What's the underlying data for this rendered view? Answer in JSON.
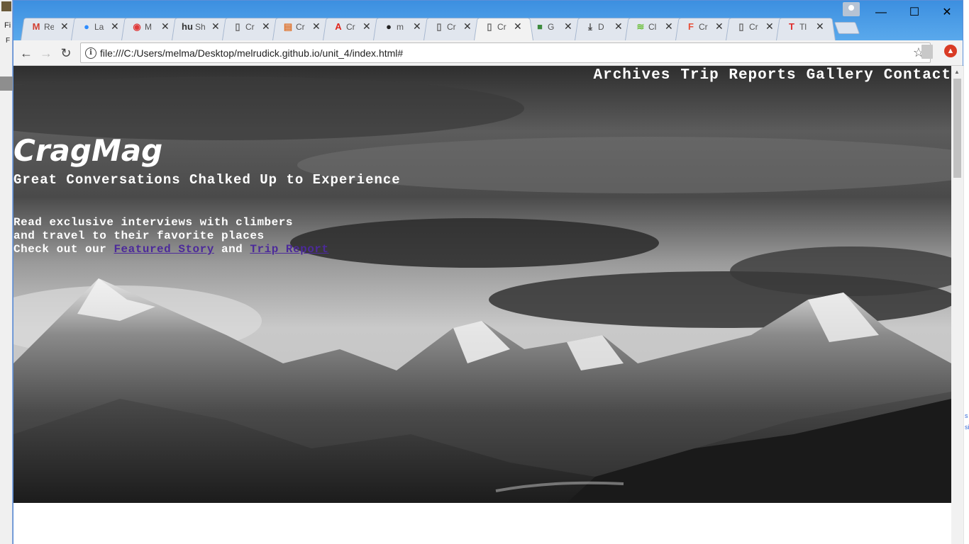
{
  "browser": {
    "tabs": [
      {
        "icon": "gmail-icon",
        "title": "Re",
        "active": false
      },
      {
        "icon": "zoom-icon",
        "title": "La",
        "active": false
      },
      {
        "icon": "app-icon",
        "title": "M",
        "active": false
      },
      {
        "icon": "shield-icon",
        "title": "Sh",
        "active": false
      },
      {
        "icon": "page-icon",
        "title": "Cr",
        "active": false
      },
      {
        "icon": "calendar-icon",
        "title": "Cr",
        "active": false
      },
      {
        "icon": "adobe-icon",
        "title": "Cr",
        "active": false
      },
      {
        "icon": "github-icon",
        "title": "m",
        "active": false
      },
      {
        "icon": "page-icon",
        "title": "Cr",
        "active": false
      },
      {
        "icon": "page-icon",
        "title": "Cr",
        "active": true
      },
      {
        "icon": "green-icon",
        "title": "G",
        "active": false
      },
      {
        "icon": "download-icon",
        "title": "D",
        "active": false
      },
      {
        "icon": "graph-icon",
        "title": "Cl",
        "active": false
      },
      {
        "icon": "f-icon",
        "title": "Cr",
        "active": false
      },
      {
        "icon": "page-icon",
        "title": "Cr",
        "active": false
      },
      {
        "icon": "t-icon",
        "title": "Tl",
        "active": false
      }
    ],
    "url": "file:///C:/Users/melma/Desktop/melrudick.github.io/unit_4/index.html#",
    "controls": {
      "minimize": "—",
      "maximize": "☐",
      "close": "✕"
    }
  },
  "page": {
    "nav": [
      "Archives",
      "Trip Reports",
      "Gallery",
      "Contact"
    ],
    "brand": "CragMag",
    "tagline": "Great Conversations Chalked Up to Experience",
    "blurb_line1": "Read exclusive interviews with climbers",
    "blurb_line2": "and travel to their favorite places",
    "blurb_line3_prefix": "Check out our",
    "link_featured": "Featured Story",
    "blurb_and": "and",
    "link_trip": "Trip Report"
  },
  "behind_window": {
    "top_label": "Fi",
    "second_label": "F"
  }
}
